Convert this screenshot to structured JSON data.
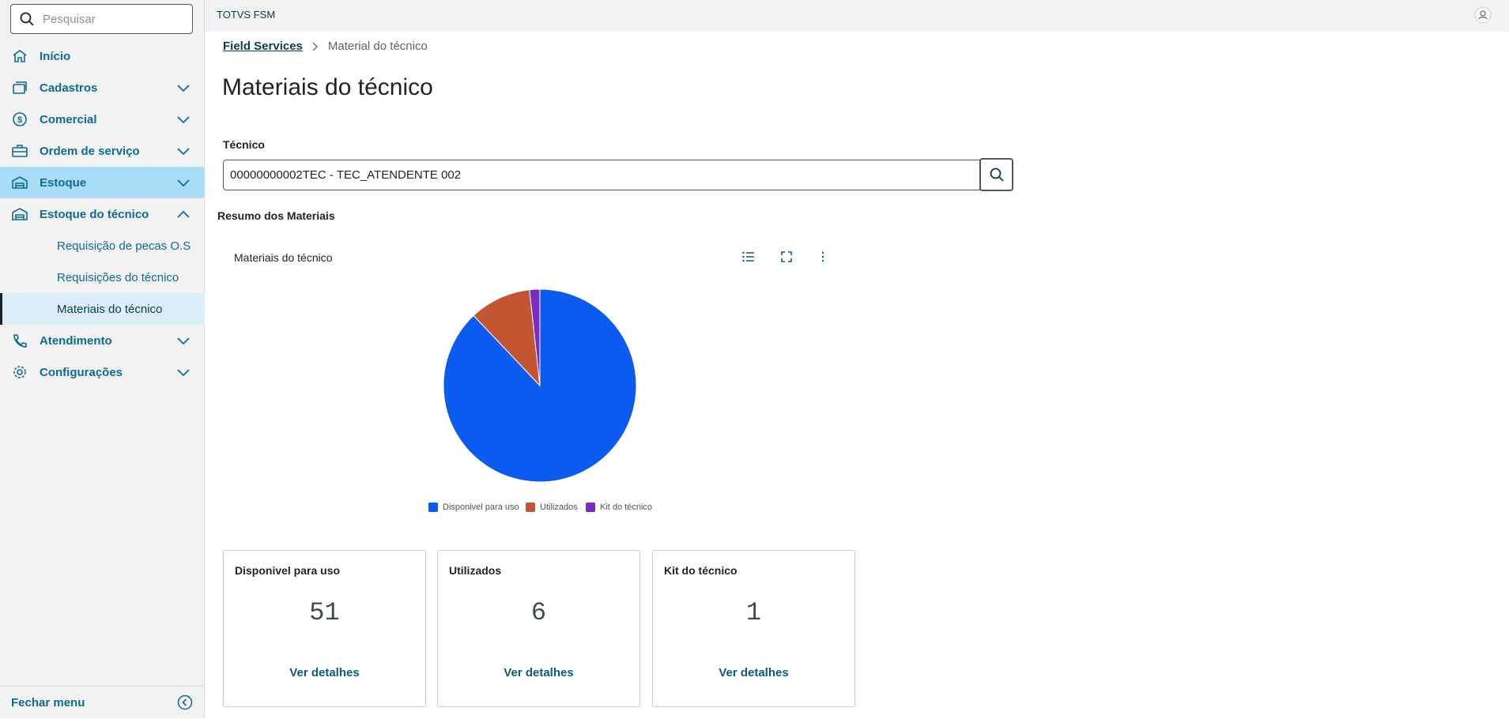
{
  "sidebar": {
    "search_placeholder": "Pesquisar",
    "items": [
      {
        "label": "Início",
        "icon": "home-icon"
      },
      {
        "label": "Cadastros",
        "icon": "cards-icon"
      },
      {
        "label": "Comercial",
        "icon": "dollar-icon"
      },
      {
        "label": "Ordem de serviço",
        "icon": "briefcase-icon"
      },
      {
        "label": "Estoque",
        "icon": "warehouse-icon"
      },
      {
        "label": "Estoque do técnico",
        "icon": "warehouse-icon"
      },
      {
        "label": "Atendimento",
        "icon": "phone-icon"
      },
      {
        "label": "Configurações",
        "icon": "gear-icon"
      }
    ],
    "subitems": [
      {
        "label": "Requisição de pecas O.S"
      },
      {
        "label": "Requisições do técnico"
      },
      {
        "label": "Materiais do técnico"
      }
    ],
    "footer_label": "Fechar menu"
  },
  "topbar": {
    "app_name": "TOTVS FSM"
  },
  "breadcrumb": {
    "root": "Field Services",
    "current": "Material do técnico"
  },
  "page": {
    "title": "Materiais do técnico",
    "field_label": "Técnico",
    "field_value": "00000000002TEC - TEC_ATENDENTE 002",
    "section_title": "Resumo dos Materiais"
  },
  "chart_data": {
    "type": "pie",
    "title": "Materiais do técnico",
    "categories": [
      "Disponivel para uso",
      "Utilizados",
      "Kit do técnico"
    ],
    "values": [
      51,
      6,
      1
    ],
    "colors": [
      "#0c5bf0",
      "#c45533",
      "#7a2cbf"
    ],
    "legend": "bottom"
  },
  "cards": [
    {
      "title": "Disponivel para uso",
      "value": "51",
      "link": "Ver detalhes"
    },
    {
      "title": "Utilizados",
      "value": "6",
      "link": "Ver detalhes"
    },
    {
      "title": "Kit do técnico",
      "value": "1",
      "link": "Ver detalhes"
    }
  ]
}
